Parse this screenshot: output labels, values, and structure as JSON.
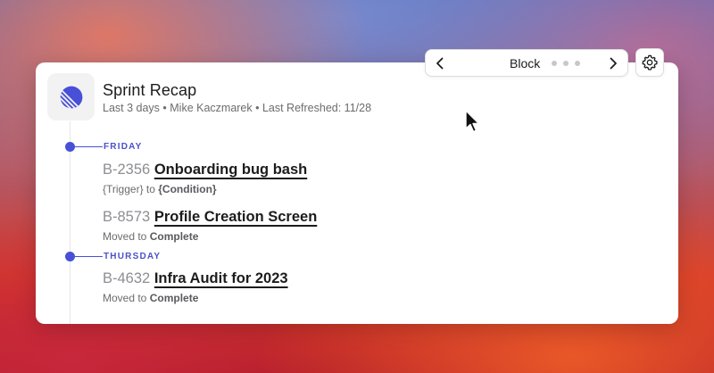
{
  "colors": {
    "accent": "#4750d6",
    "title_text": "#1c1c1e",
    "muted_text": "#6c6c70",
    "id_text": "#8e8e93",
    "card_bg": "#ffffff"
  },
  "icons": {
    "app": "linear-logo-icon",
    "prev": "chevron-left-icon",
    "next": "chevron-right-icon",
    "settings": "gear-icon",
    "cursor": "mouse-pointer-icon"
  },
  "header": {
    "title": "Sprint Recap",
    "subtitle": "Last 3 days • Mike Kaczmarek • Last Refreshed: 11/28"
  },
  "switcher": {
    "label": "Block",
    "pages": 3
  },
  "days": [
    {
      "label": "FRIDAY",
      "items": [
        {
          "id": "B-2356",
          "name": "Onboarding bug bash",
          "sub_prefix": "{Trigger} to ",
          "sub_bold": "{Condition}"
        },
        {
          "id": "B-8573",
          "name": "Profile Creation Screen",
          "sub_prefix": "Moved to ",
          "sub_bold": "Complete"
        }
      ]
    },
    {
      "label": "THURSDAY",
      "items": [
        {
          "id": "B-4632",
          "name": "Infra Audit for 2023",
          "sub_prefix": "Moved to ",
          "sub_bold": "Complete"
        }
      ]
    }
  ]
}
